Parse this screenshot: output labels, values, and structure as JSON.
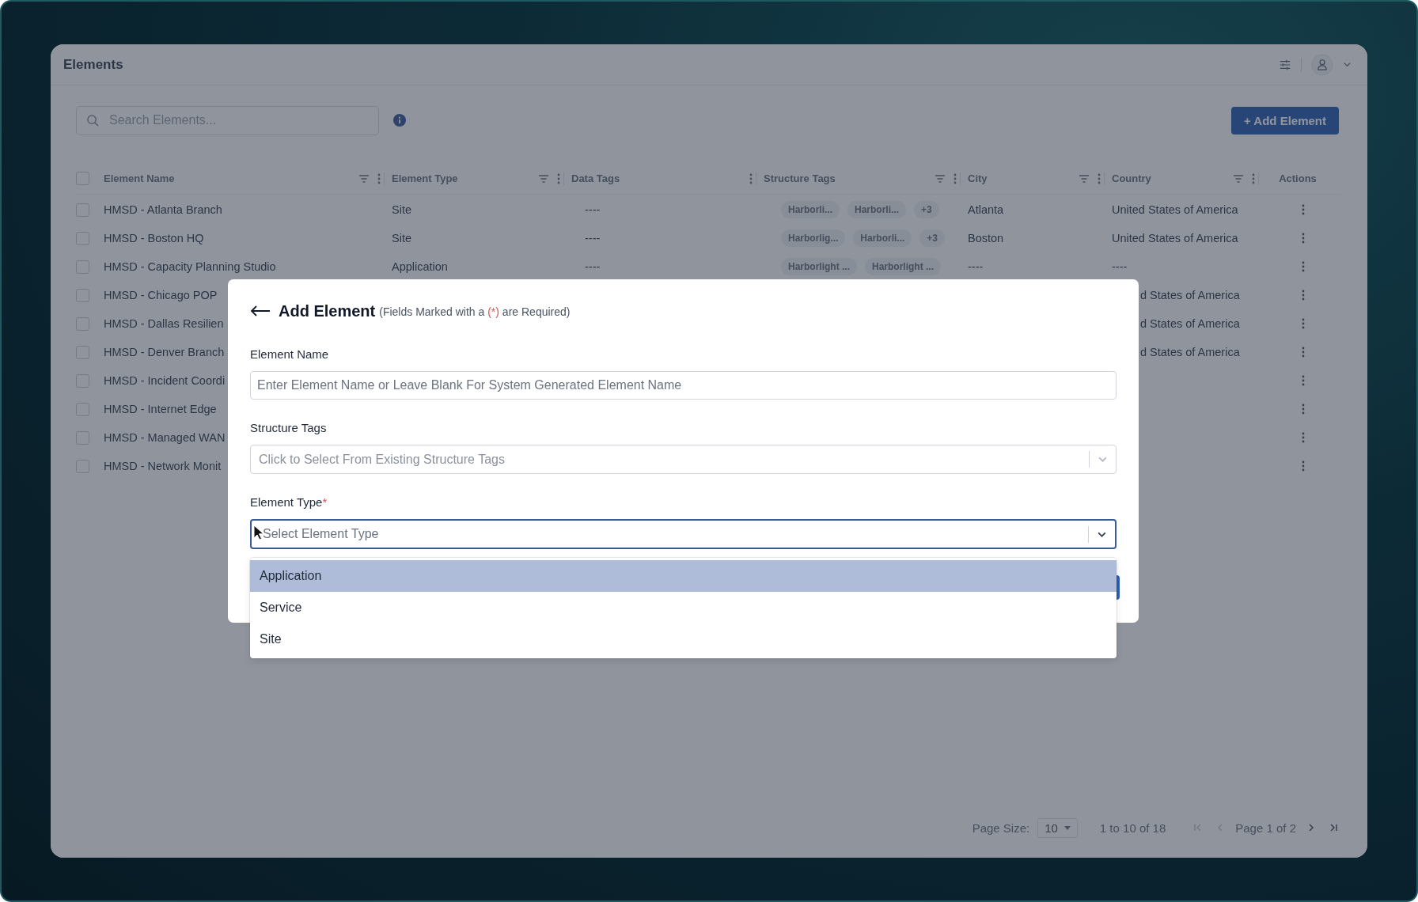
{
  "window": {
    "title": "Elements"
  },
  "search": {
    "placeholder": "Search Elements..."
  },
  "add_button": "+ Add Element",
  "table": {
    "select_all_checked": false,
    "columns": [
      {
        "label": "Element Name",
        "filterable": true,
        "menu": true
      },
      {
        "label": "Element Type",
        "filterable": true,
        "menu": true
      },
      {
        "label": "Data Tags",
        "filterable": false,
        "menu": true
      },
      {
        "label": "Structure Tags",
        "filterable": true,
        "menu": true
      },
      {
        "label": "City",
        "filterable": true,
        "menu": true
      },
      {
        "label": "Country",
        "filterable": true,
        "menu": true
      },
      {
        "label": "Actions",
        "filterable": false,
        "menu": false
      }
    ],
    "rows": [
      {
        "checked": false,
        "name": "HMSD - Atlanta Branch",
        "type": "Site",
        "data_tags": "----",
        "structure_tags": [
          "Harborli...",
          "Harborli..."
        ],
        "more_tags": "+3",
        "city": "Atlanta",
        "country": "United States of America"
      },
      {
        "checked": false,
        "name": "HMSD - Boston HQ",
        "type": "Site",
        "data_tags": "----",
        "structure_tags": [
          "Harborlig...",
          "Harborli..."
        ],
        "more_tags": "+3",
        "city": "Boston",
        "country": "United States of America"
      },
      {
        "checked": false,
        "name": "HMSD - Capacity Planning Studio",
        "type": "Application",
        "data_tags": "----",
        "structure_tags": [
          "Harborlight ...",
          "Harborlight ..."
        ],
        "city": "----",
        "country": "----"
      },
      {
        "checked": false,
        "name": "HMSD - Chicago POP",
        "country": "d States of America"
      },
      {
        "checked": false,
        "name": "HMSD - Dallas Resilien",
        "country": "d States of America"
      },
      {
        "checked": false,
        "name": "HMSD - Denver Branch",
        "country": "d States of America"
      },
      {
        "checked": false,
        "name": "HMSD - Incident Coordi"
      },
      {
        "checked": false,
        "name": "HMSD - Internet Edge"
      },
      {
        "checked": false,
        "name": "HMSD - Managed WAN"
      },
      {
        "checked": false,
        "name": "HMSD - Network Monit"
      }
    ]
  },
  "pagination": {
    "page_size_label": "Page Size:",
    "page_size": "10",
    "range": "1 to 10 of 18",
    "page": "Page 1 of 2",
    "first_disabled": true,
    "prev_disabled": true,
    "next_disabled": false,
    "last_disabled": false
  },
  "dialog": {
    "title": "Add Element",
    "note": {
      "before": "(Fields Marked with a",
      "mark": "(*)",
      "after": "are Required)"
    },
    "fields": [
      {
        "kind": "text",
        "label": "Element Name",
        "placeholder": "Enter Element Name or Leave Blank For System Generated Element Name",
        "focused": false
      },
      {
        "kind": "select",
        "label": "Structure Tags",
        "placeholder": "Click to Select From Existing Structure Tags",
        "focused": false,
        "open": false
      },
      {
        "kind": "select",
        "label": "Element Type",
        "required_mark": "*",
        "placeholder": "Select Element Type",
        "focused": true,
        "open": true,
        "options": [
          {
            "label": "Application",
            "highlighted": true
          },
          {
            "label": "Service",
            "highlighted": false
          },
          {
            "label": "Site",
            "highlighted": false
          }
        ]
      }
    ]
  }
}
